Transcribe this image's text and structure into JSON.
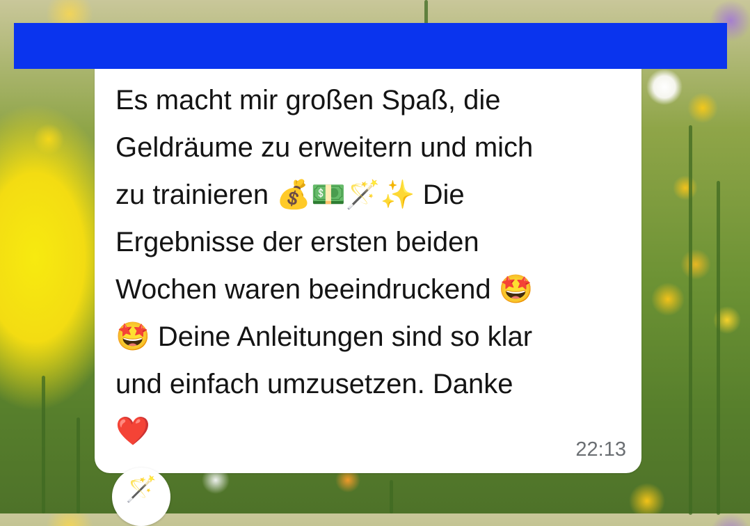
{
  "message": {
    "text": "Es macht mir großen Spaß, die\nGeldräume zu erweitern und mich\nzu trainieren 💰💵🪄✨ Die\nErgebnisse der ersten beiden\nWochen waren beeindruckend 🤩\n🤩 Deine Anleitungen sind so klar\nund einfach umzusetzen. Danke\n❤️",
    "time": "22:13",
    "reaction": "🪄"
  },
  "colors": {
    "redaction_bar": "#0a34ee",
    "bubble": "#ffffff",
    "text": "#141414",
    "timestamp": "#6b6f73"
  },
  "icons": {
    "reaction": "magic-wand-icon"
  }
}
